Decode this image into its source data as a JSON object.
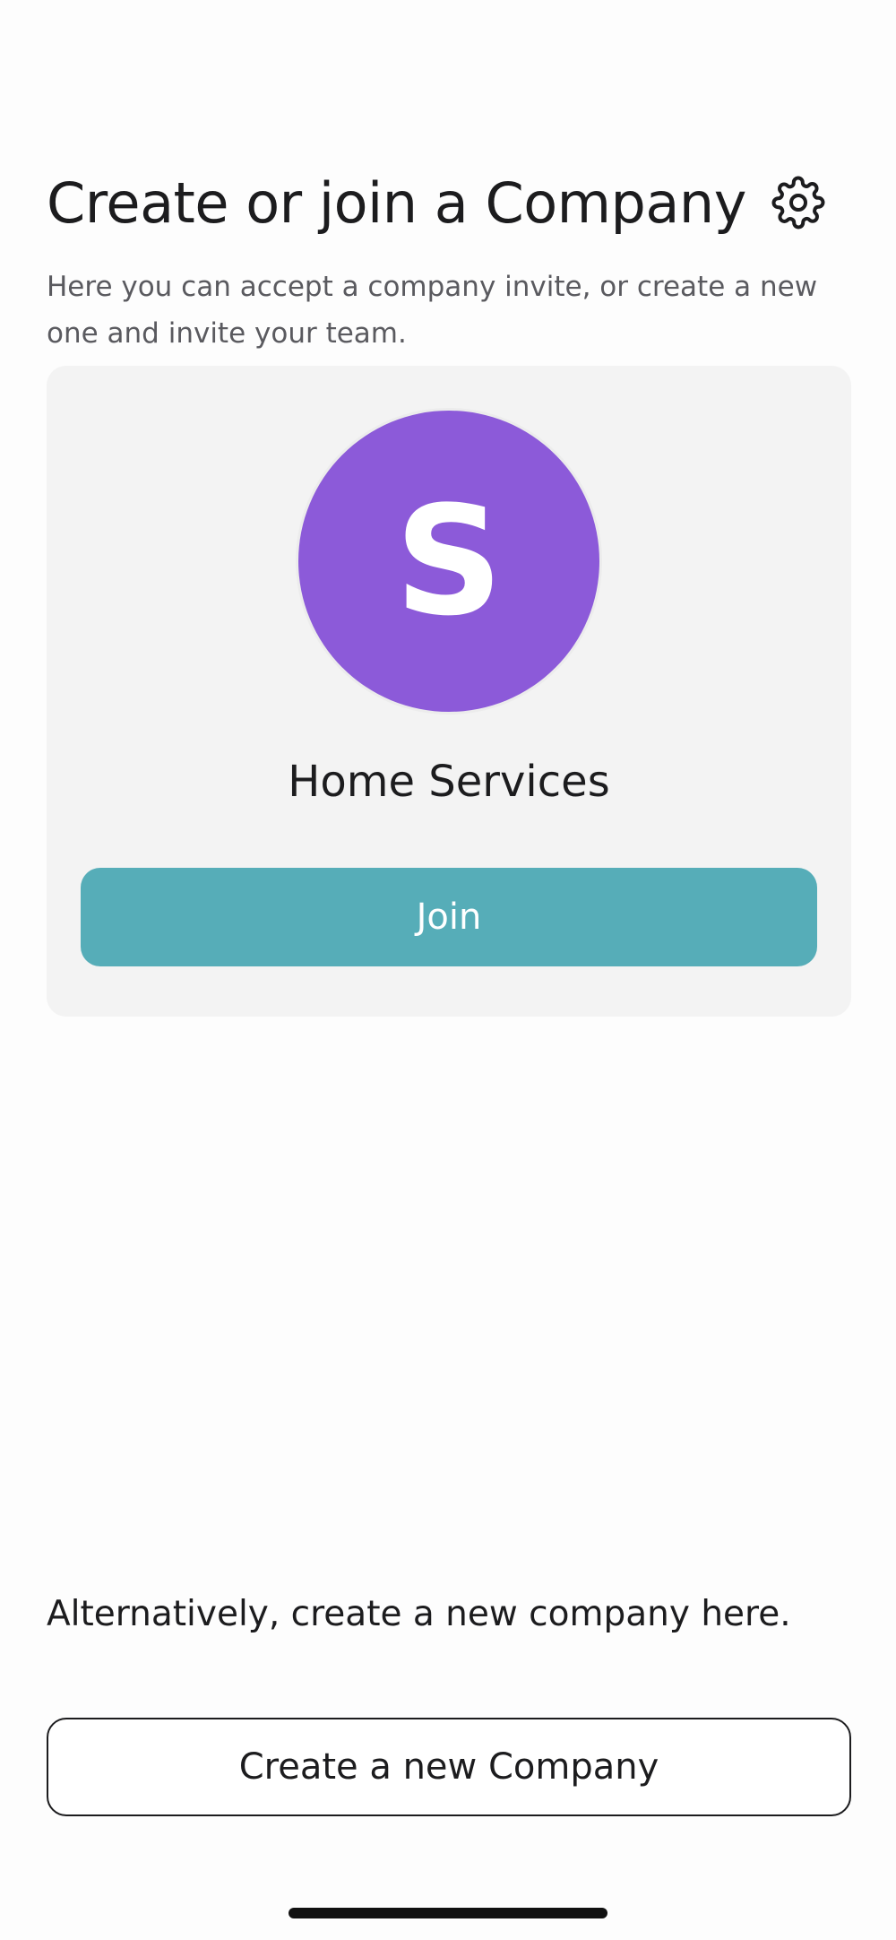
{
  "header": {
    "title": "Create or join a Company",
    "settings_icon": "gear-icon",
    "subtitle": "Here you can accept a company invite, or create a new one and invite your team."
  },
  "invite_card": {
    "avatar_letter": "S",
    "avatar_color": "#8c5ad9",
    "company_name": "Home Services",
    "join_label": "Join",
    "join_color": "#56adb8"
  },
  "alternative": {
    "text": "Alternatively, create a new company here.",
    "create_label": "Create a new Company"
  }
}
